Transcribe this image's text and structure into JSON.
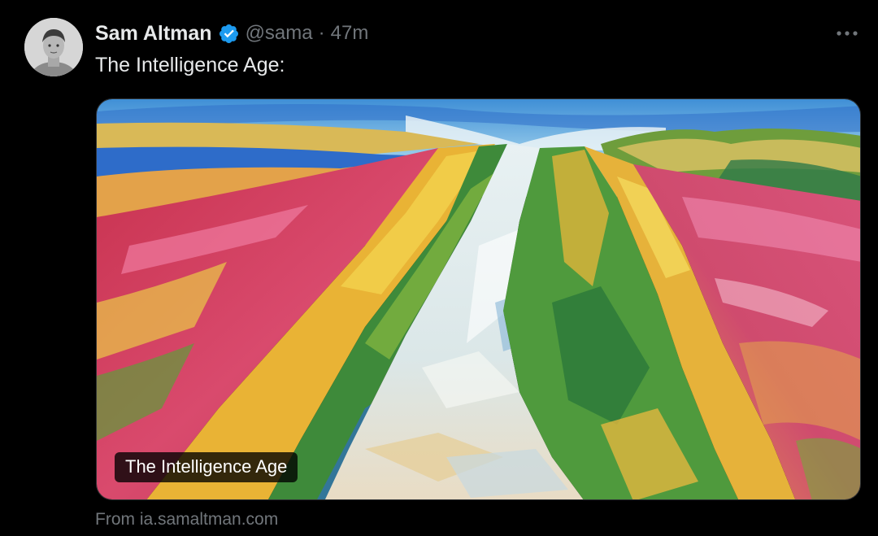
{
  "tweet": {
    "author": {
      "display_name": "Sam Altman",
      "handle": "@sama",
      "verified": true,
      "avatar_icon": "avatar-photo"
    },
    "separator": "·",
    "time": "47m",
    "more_icon": "more-options-icon",
    "text": "The Intelligence Age:",
    "card": {
      "image_subject": "impressionist painting of a path through colorful fields",
      "title": "The Intelligence Age",
      "source": "From ia.samaltman.com"
    }
  },
  "colors": {
    "background": "#000000",
    "text_primary": "#e7e9ea",
    "text_secondary": "#71767b",
    "verified_badge": "#1d9bf0"
  }
}
